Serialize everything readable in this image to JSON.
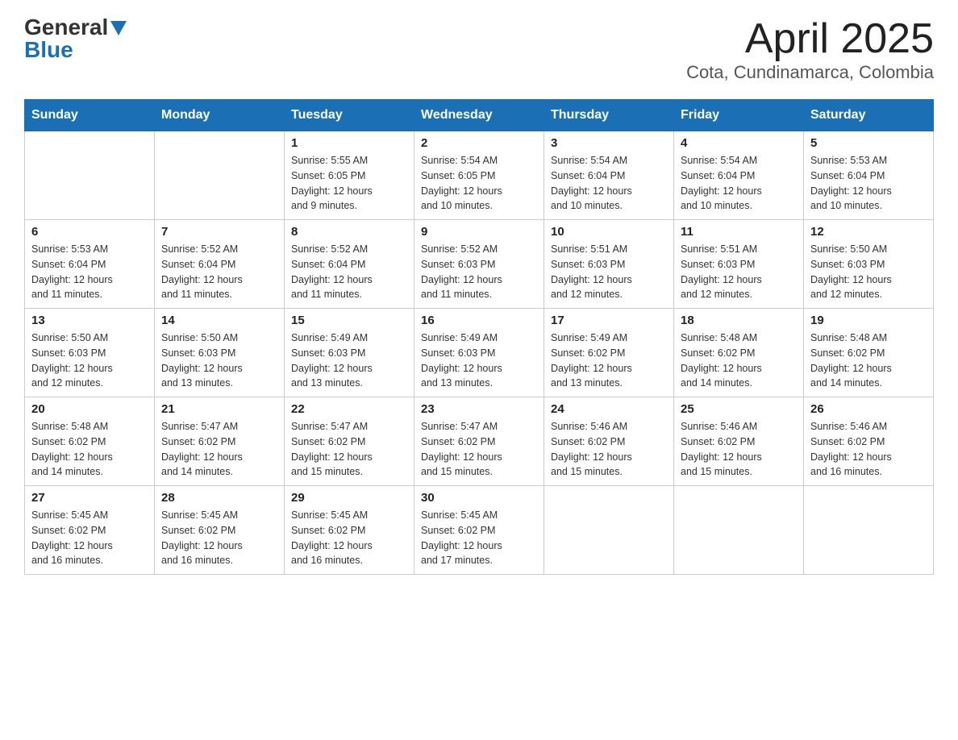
{
  "logo": {
    "general": "General",
    "blue": "Blue"
  },
  "header": {
    "title": "April 2025",
    "subtitle": "Cota, Cundinamarca, Colombia"
  },
  "columns": [
    "Sunday",
    "Monday",
    "Tuesday",
    "Wednesday",
    "Thursday",
    "Friday",
    "Saturday"
  ],
  "weeks": [
    [
      {
        "day": "",
        "info": ""
      },
      {
        "day": "",
        "info": ""
      },
      {
        "day": "1",
        "info": "Sunrise: 5:55 AM\nSunset: 6:05 PM\nDaylight: 12 hours\nand 9 minutes."
      },
      {
        "day": "2",
        "info": "Sunrise: 5:54 AM\nSunset: 6:05 PM\nDaylight: 12 hours\nand 10 minutes."
      },
      {
        "day": "3",
        "info": "Sunrise: 5:54 AM\nSunset: 6:04 PM\nDaylight: 12 hours\nand 10 minutes."
      },
      {
        "day": "4",
        "info": "Sunrise: 5:54 AM\nSunset: 6:04 PM\nDaylight: 12 hours\nand 10 minutes."
      },
      {
        "day": "5",
        "info": "Sunrise: 5:53 AM\nSunset: 6:04 PM\nDaylight: 12 hours\nand 10 minutes."
      }
    ],
    [
      {
        "day": "6",
        "info": "Sunrise: 5:53 AM\nSunset: 6:04 PM\nDaylight: 12 hours\nand 11 minutes."
      },
      {
        "day": "7",
        "info": "Sunrise: 5:52 AM\nSunset: 6:04 PM\nDaylight: 12 hours\nand 11 minutes."
      },
      {
        "day": "8",
        "info": "Sunrise: 5:52 AM\nSunset: 6:04 PM\nDaylight: 12 hours\nand 11 minutes."
      },
      {
        "day": "9",
        "info": "Sunrise: 5:52 AM\nSunset: 6:03 PM\nDaylight: 12 hours\nand 11 minutes."
      },
      {
        "day": "10",
        "info": "Sunrise: 5:51 AM\nSunset: 6:03 PM\nDaylight: 12 hours\nand 12 minutes."
      },
      {
        "day": "11",
        "info": "Sunrise: 5:51 AM\nSunset: 6:03 PM\nDaylight: 12 hours\nand 12 minutes."
      },
      {
        "day": "12",
        "info": "Sunrise: 5:50 AM\nSunset: 6:03 PM\nDaylight: 12 hours\nand 12 minutes."
      }
    ],
    [
      {
        "day": "13",
        "info": "Sunrise: 5:50 AM\nSunset: 6:03 PM\nDaylight: 12 hours\nand 12 minutes."
      },
      {
        "day": "14",
        "info": "Sunrise: 5:50 AM\nSunset: 6:03 PM\nDaylight: 12 hours\nand 13 minutes."
      },
      {
        "day": "15",
        "info": "Sunrise: 5:49 AM\nSunset: 6:03 PM\nDaylight: 12 hours\nand 13 minutes."
      },
      {
        "day": "16",
        "info": "Sunrise: 5:49 AM\nSunset: 6:03 PM\nDaylight: 12 hours\nand 13 minutes."
      },
      {
        "day": "17",
        "info": "Sunrise: 5:49 AM\nSunset: 6:02 PM\nDaylight: 12 hours\nand 13 minutes."
      },
      {
        "day": "18",
        "info": "Sunrise: 5:48 AM\nSunset: 6:02 PM\nDaylight: 12 hours\nand 14 minutes."
      },
      {
        "day": "19",
        "info": "Sunrise: 5:48 AM\nSunset: 6:02 PM\nDaylight: 12 hours\nand 14 minutes."
      }
    ],
    [
      {
        "day": "20",
        "info": "Sunrise: 5:48 AM\nSunset: 6:02 PM\nDaylight: 12 hours\nand 14 minutes."
      },
      {
        "day": "21",
        "info": "Sunrise: 5:47 AM\nSunset: 6:02 PM\nDaylight: 12 hours\nand 14 minutes."
      },
      {
        "day": "22",
        "info": "Sunrise: 5:47 AM\nSunset: 6:02 PM\nDaylight: 12 hours\nand 15 minutes."
      },
      {
        "day": "23",
        "info": "Sunrise: 5:47 AM\nSunset: 6:02 PM\nDaylight: 12 hours\nand 15 minutes."
      },
      {
        "day": "24",
        "info": "Sunrise: 5:46 AM\nSunset: 6:02 PM\nDaylight: 12 hours\nand 15 minutes."
      },
      {
        "day": "25",
        "info": "Sunrise: 5:46 AM\nSunset: 6:02 PM\nDaylight: 12 hours\nand 15 minutes."
      },
      {
        "day": "26",
        "info": "Sunrise: 5:46 AM\nSunset: 6:02 PM\nDaylight: 12 hours\nand 16 minutes."
      }
    ],
    [
      {
        "day": "27",
        "info": "Sunrise: 5:45 AM\nSunset: 6:02 PM\nDaylight: 12 hours\nand 16 minutes."
      },
      {
        "day": "28",
        "info": "Sunrise: 5:45 AM\nSunset: 6:02 PM\nDaylight: 12 hours\nand 16 minutes."
      },
      {
        "day": "29",
        "info": "Sunrise: 5:45 AM\nSunset: 6:02 PM\nDaylight: 12 hours\nand 16 minutes."
      },
      {
        "day": "30",
        "info": "Sunrise: 5:45 AM\nSunset: 6:02 PM\nDaylight: 12 hours\nand 17 minutes."
      },
      {
        "day": "",
        "info": ""
      },
      {
        "day": "",
        "info": ""
      },
      {
        "day": "",
        "info": ""
      }
    ]
  ]
}
